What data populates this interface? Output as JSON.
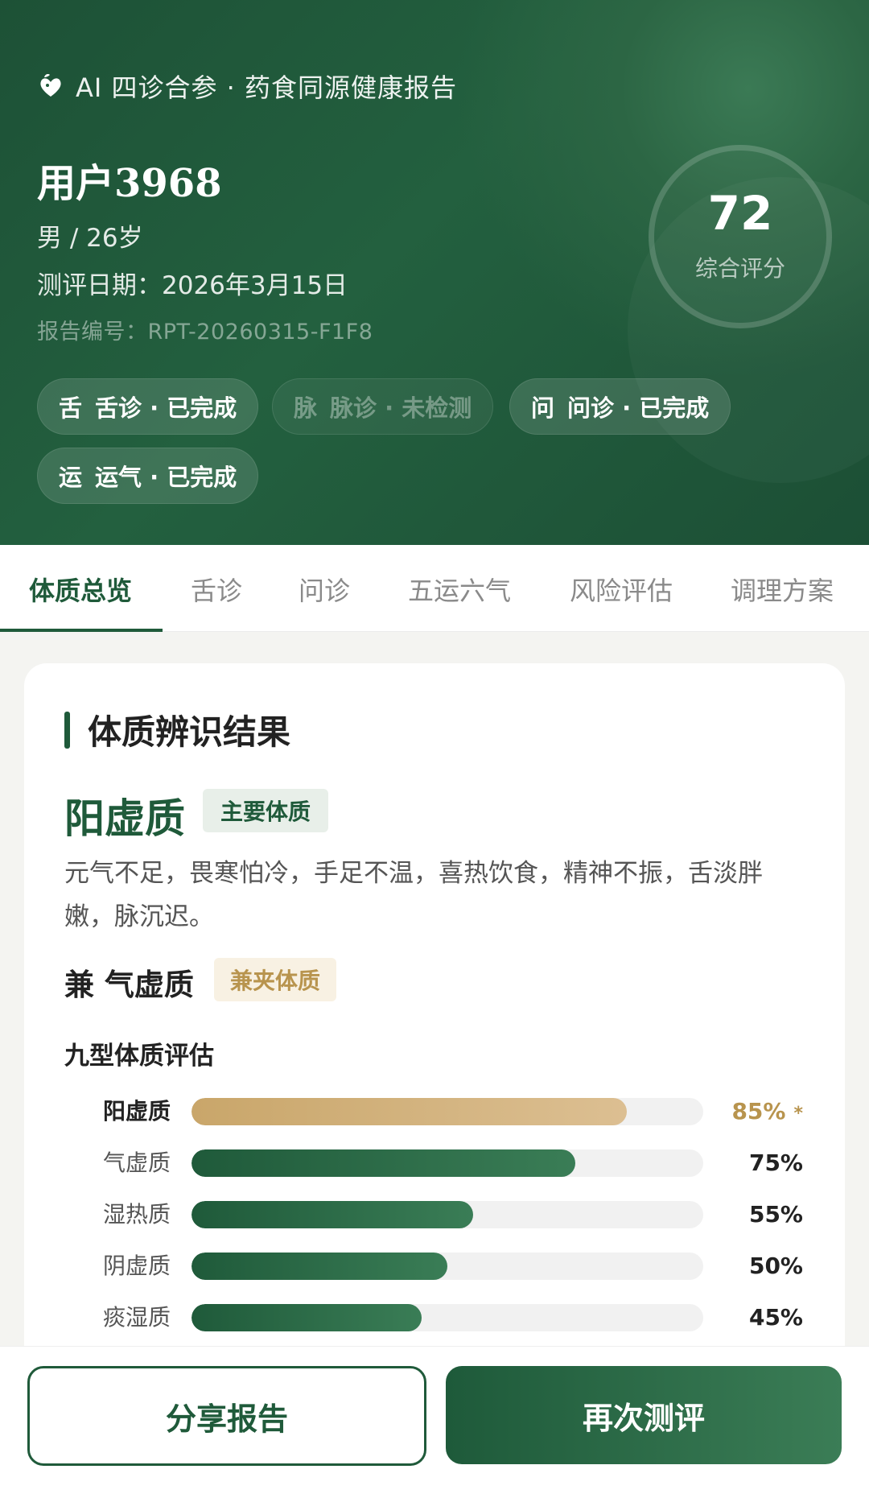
{
  "header": {
    "brand_icon": "heart-leaf-icon",
    "brand_text": "AI 四诊合参 · 药食同源健康报告",
    "user_name": "用户3968",
    "user_meta": "男 / 26岁",
    "eval_date": "测评日期：2026年3月15日",
    "report_no": "报告编号：RPT-20260315-F1F8",
    "score": "72",
    "score_label": "综合评分",
    "chips": [
      {
        "icon": "舌",
        "label": "舌诊 · 已完成",
        "active": true
      },
      {
        "icon": "脉",
        "label": "脉诊 · 未检测",
        "active": false
      },
      {
        "icon": "问",
        "label": "问诊 · 已完成",
        "active": true
      },
      {
        "icon": "运",
        "label": "运气 · 已完成",
        "active": true
      }
    ]
  },
  "tabs": [
    "体质总览",
    "舌诊",
    "问诊",
    "五运六气",
    "风险评估",
    "调理方案"
  ],
  "active_tab": "体质总览",
  "result": {
    "title": "体质辨识结果",
    "main_type": "阳虚质",
    "main_tag": "主要体质",
    "description": "元气不足，畏寒怕冷，手足不温，喜热饮食，精神不振，舌淡胖嫩，脉沉迟。",
    "sub_type": "兼 气虚质",
    "sub_tag": "兼夹体质",
    "nine_title": "九型体质评估",
    "bars": [
      {
        "label": "阳虚质",
        "value": 85,
        "pct": "85%",
        "mark": "*",
        "top": true
      },
      {
        "label": "气虚质",
        "value": 75,
        "pct": "75%",
        "mark": "",
        "top": false
      },
      {
        "label": "湿热质",
        "value": 55,
        "pct": "55%",
        "mark": "",
        "top": false
      },
      {
        "label": "阴虚质",
        "value": 50,
        "pct": "50%",
        "mark": "",
        "top": false
      },
      {
        "label": "痰湿质",
        "value": 45,
        "pct": "45%",
        "mark": "",
        "top": false
      }
    ]
  },
  "footer": {
    "share_label": "分享报告",
    "retest_label": "再次测评"
  },
  "colors": {
    "primary": "#1f5a3a",
    "gold": "#b8944e"
  }
}
